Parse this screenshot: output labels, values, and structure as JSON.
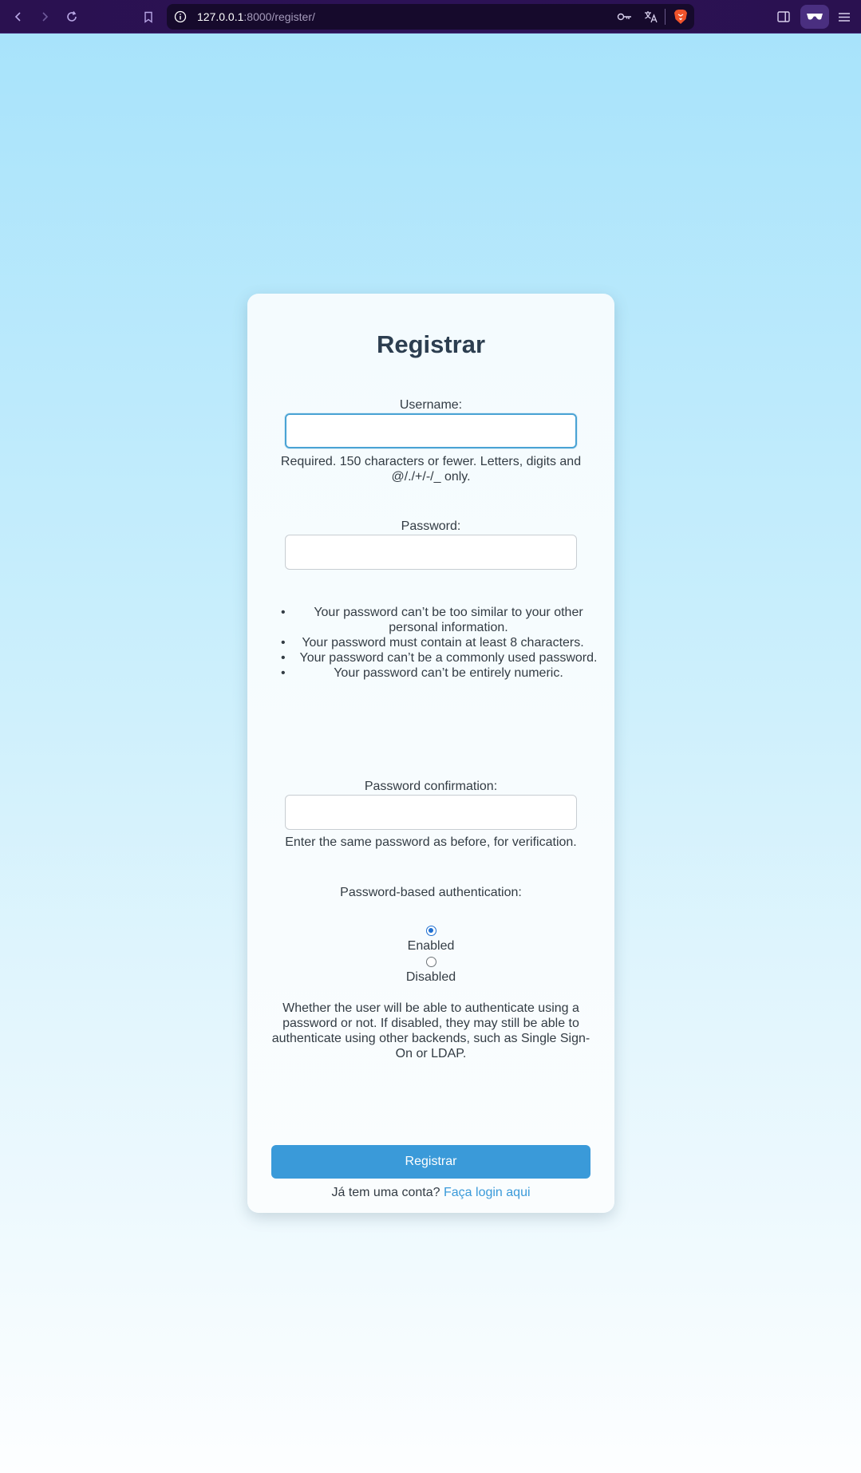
{
  "browser": {
    "url_host": "127.0.0.1",
    "url_path": ":8000/register/"
  },
  "form": {
    "title": "Registrar",
    "username": {
      "label": "Username:",
      "value": "",
      "help": "Required. 150 characters or fewer. Letters, digits and @/./+/-/_ only."
    },
    "password": {
      "label": "Password:",
      "value": "",
      "rules": [
        "Your password can’t be too similar to your other personal information.",
        "Your password must contain at least 8 characters.",
        "Your password can’t be a commonly used password.",
        "Your password can’t be entirely numeric."
      ]
    },
    "password_confirmation": {
      "label": "Password confirmation:",
      "value": "",
      "help": "Enter the same password as before, for verification."
    },
    "password_auth": {
      "label": "Password-based authentication:",
      "options": [
        {
          "label": "Enabled",
          "checked": true
        },
        {
          "label": "Disabled",
          "checked": false
        }
      ],
      "help": "Whether the user will be able to authenticate using a password or not. If disabled, they may still be able to authenticate using other backends, such as Single Sign-On or LDAP."
    },
    "submit_label": "Registrar",
    "login_prompt": "Já tem uma conta?",
    "login_link": "Faça login aqui"
  },
  "colors": {
    "accent": "#3a9ad9",
    "title": "#2c3e50",
    "toolbar": "#2c1256"
  }
}
